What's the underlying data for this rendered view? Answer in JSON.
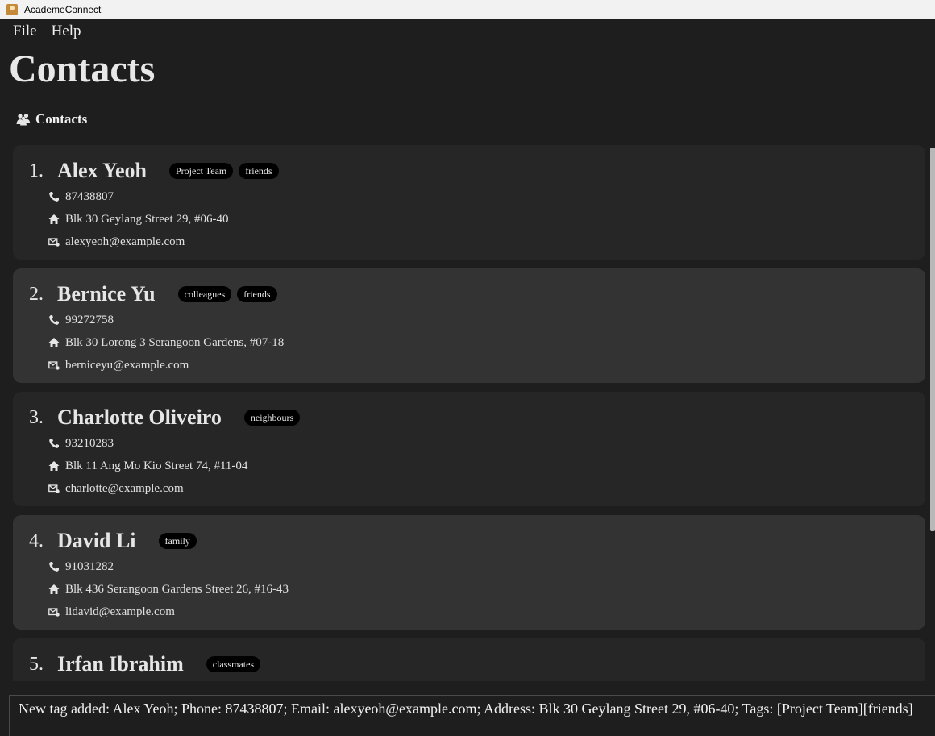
{
  "window": {
    "title": "AcademeConnect"
  },
  "menu": {
    "file": "File",
    "help": "Help"
  },
  "page_title": "Contacts",
  "section_header": "Contacts",
  "contacts": [
    {
      "index": "1.",
      "name": "Alex Yeoh",
      "tags": [
        "Project Team",
        "friends"
      ],
      "phone": "87438807",
      "address": "Blk 30 Geylang Street 29, #06-40",
      "email": "alexyeoh@example.com"
    },
    {
      "index": "2.",
      "name": "Bernice Yu",
      "tags": [
        "colleagues",
        "friends"
      ],
      "phone": "99272758",
      "address": "Blk 30 Lorong 3 Serangoon Gardens, #07-18",
      "email": "berniceyu@example.com"
    },
    {
      "index": "3.",
      "name": "Charlotte Oliveiro",
      "tags": [
        "neighbours"
      ],
      "phone": "93210283",
      "address": "Blk 11 Ang Mo Kio Street 74, #11-04",
      "email": "charlotte@example.com"
    },
    {
      "index": "4.",
      "name": "David Li",
      "tags": [
        "family"
      ],
      "phone": "91031282",
      "address": "Blk 436 Serangoon Gardens Street 26, #16-43",
      "email": "lidavid@example.com"
    },
    {
      "index": "5.",
      "name": "Irfan Ibrahim",
      "tags": [
        "classmates"
      ],
      "phone": "",
      "address": "",
      "email": ""
    }
  ],
  "result_message": "New tag added: Alex Yeoh; Phone: 87438807; Email: alexyeoh@example.com; Address: Blk 30 Geylang Street 29, #06-40; Tags: [Project Team][friends]"
}
